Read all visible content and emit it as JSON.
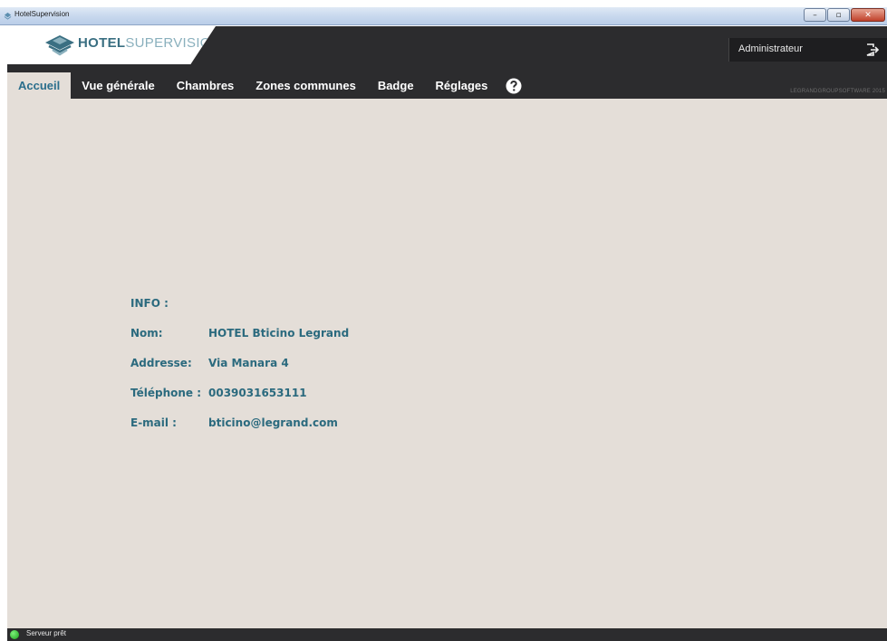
{
  "window": {
    "title": "HotelSupervision",
    "minimize_glyph": "–",
    "maximize_glyph": "▫",
    "close_glyph": "✕"
  },
  "header": {
    "logo_bold": "HOTEL",
    "logo_light": "SUPERVISION",
    "user": "Administrateur",
    "logout_icon": "logout-icon",
    "brand": "LEGRANDGROUPSOFTWARE 2015"
  },
  "nav": {
    "items": [
      {
        "label": "Accueil",
        "active": true
      },
      {
        "label": "Vue générale",
        "active": false
      },
      {
        "label": "Chambres",
        "active": false
      },
      {
        "label": "Zones communes",
        "active": false
      },
      {
        "label": "Badge",
        "active": false
      },
      {
        "label": "Réglages",
        "active": false
      }
    ],
    "help_icon": "help-icon"
  },
  "info": {
    "heading": "INFO :",
    "rows": [
      {
        "label": "Nom:",
        "value": "HOTEL Bticino Legrand"
      },
      {
        "label": "Addresse:",
        "value": "Via Manara 4"
      },
      {
        "label": "Téléphone :",
        "value": "0039031653111"
      },
      {
        "label": "E-mail :",
        "value": "bticino@legrand.com"
      }
    ]
  },
  "status": {
    "text": "Serveur prêt",
    "color": "#22b022"
  },
  "colors": {
    "accent": "#2b6a7e",
    "header_bg": "#2c2c2e",
    "content_bg": "#e4ded8"
  }
}
